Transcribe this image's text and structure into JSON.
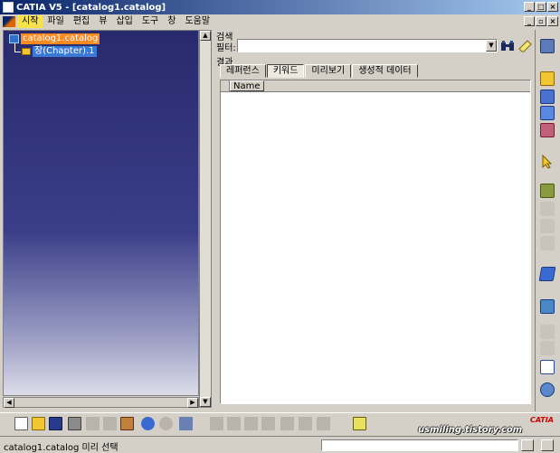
{
  "window": {
    "title": "CATIA V5 - [catalog1.catalog]"
  },
  "menu": {
    "items": [
      "시작",
      "파일",
      "편집",
      "뷰",
      "삽입",
      "도구",
      "창",
      "도움말"
    ],
    "active_index": 0
  },
  "tree": {
    "root_label": "catalog1.catalog",
    "child_label": "장(Chapter).1"
  },
  "search": {
    "section_title": "검색",
    "filter_label": "필터:",
    "filter_value": "",
    "results_title": "결과",
    "tabs": [
      "레퍼런스",
      "키워드",
      "미리보기",
      "생성적 데이터"
    ],
    "selected_tab": 1,
    "columns": [
      "Name"
    ]
  },
  "watermark": "usmiling.tistory.com",
  "logo_text": "CATIA",
  "status": {
    "text": "catalog1.catalog 미리 선택"
  },
  "colors": {
    "title_bar": "#0a246a",
    "tree_selection_root": "#ff8a1f",
    "tree_selection_child": "#3a79d8",
    "active_menu": "#f6e24a"
  }
}
